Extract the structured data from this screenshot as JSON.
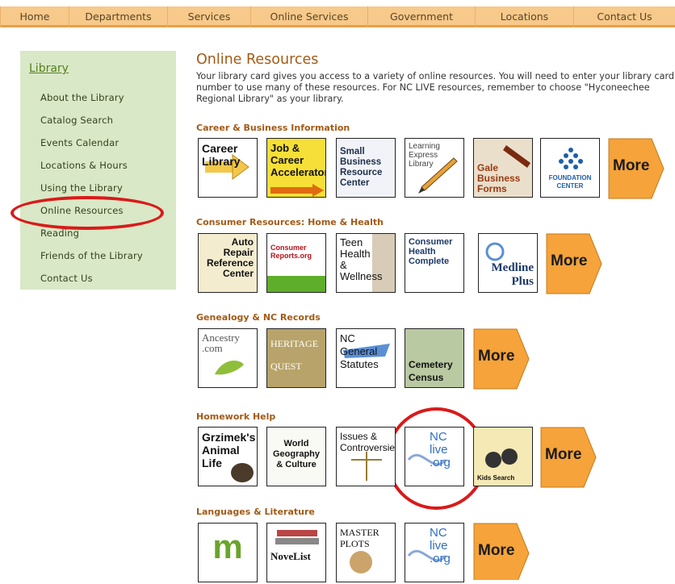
{
  "nav": {
    "items": [
      "Home",
      "Departments",
      "Services",
      "Online Services",
      "Government",
      "Locations",
      "Contact Us"
    ]
  },
  "sidebar": {
    "title": "Library",
    "links": [
      "About the Library",
      "Catalog Search",
      "Events Calendar",
      "Locations & Hours",
      "Using the Library",
      "Online Resources",
      "Reading",
      "Friends of the Library",
      "Contact Us"
    ]
  },
  "main": {
    "heading": "Online Resources",
    "intro": "Your library card gives you access to a variety of online resources. You will need to enter your library card number to use many of these resources. For NC LIVE resources, remember to choose \"Hyconeechee Regional Library\" as your library."
  },
  "categories": [
    {
      "title": "Career & Business Information",
      "tiles": [
        "Career\nLibrary",
        "Job &\nCareer\nAccelerator",
        "Small\nBusiness\nResource\nCenter",
        "Learning\nExpress\nLibrary",
        "Gale\nBusiness\nForms",
        "FOUNDATION\nCENTER"
      ],
      "more": "More"
    },
    {
      "title": "Consumer Resources: Home & Health",
      "tiles": [
        "Auto\nRepair\nReference\nCenter",
        "Consumer\nReports.org",
        "Teen\nHealth\n&\nWellness",
        "Consumer\nHealth\nComplete",
        "Medline\nPlus"
      ],
      "more": "More"
    },
    {
      "title": "Genealogy & NC Records",
      "tiles": [
        "Ancestry\n.com",
        "HERITAGE\nQUEST",
        "NC\nGeneral\nStatutes",
        "Cemetery\nCensus"
      ],
      "more": "More"
    },
    {
      "title": "Homework Help",
      "tiles": [
        "Grzimek's\nAnimal\nLife",
        "World\nGeography\n& Culture",
        "Issues &\nControversies",
        "NC\nlive\n.org",
        "Kids Search"
      ],
      "more": "More"
    },
    {
      "title": "Languages & Literature",
      "tiles": [
        "m",
        "NoveList",
        "MASTER\nPLOTS",
        "NC\nlive\n.org"
      ],
      "more": "More"
    }
  ],
  "colors": {
    "nav_bg": "#f7c98a",
    "sidebar_bg": "#d9e8c6",
    "accent": "#a35a16",
    "highlight_circle": "#d91a1a",
    "more_orange": "#f5a33a"
  }
}
